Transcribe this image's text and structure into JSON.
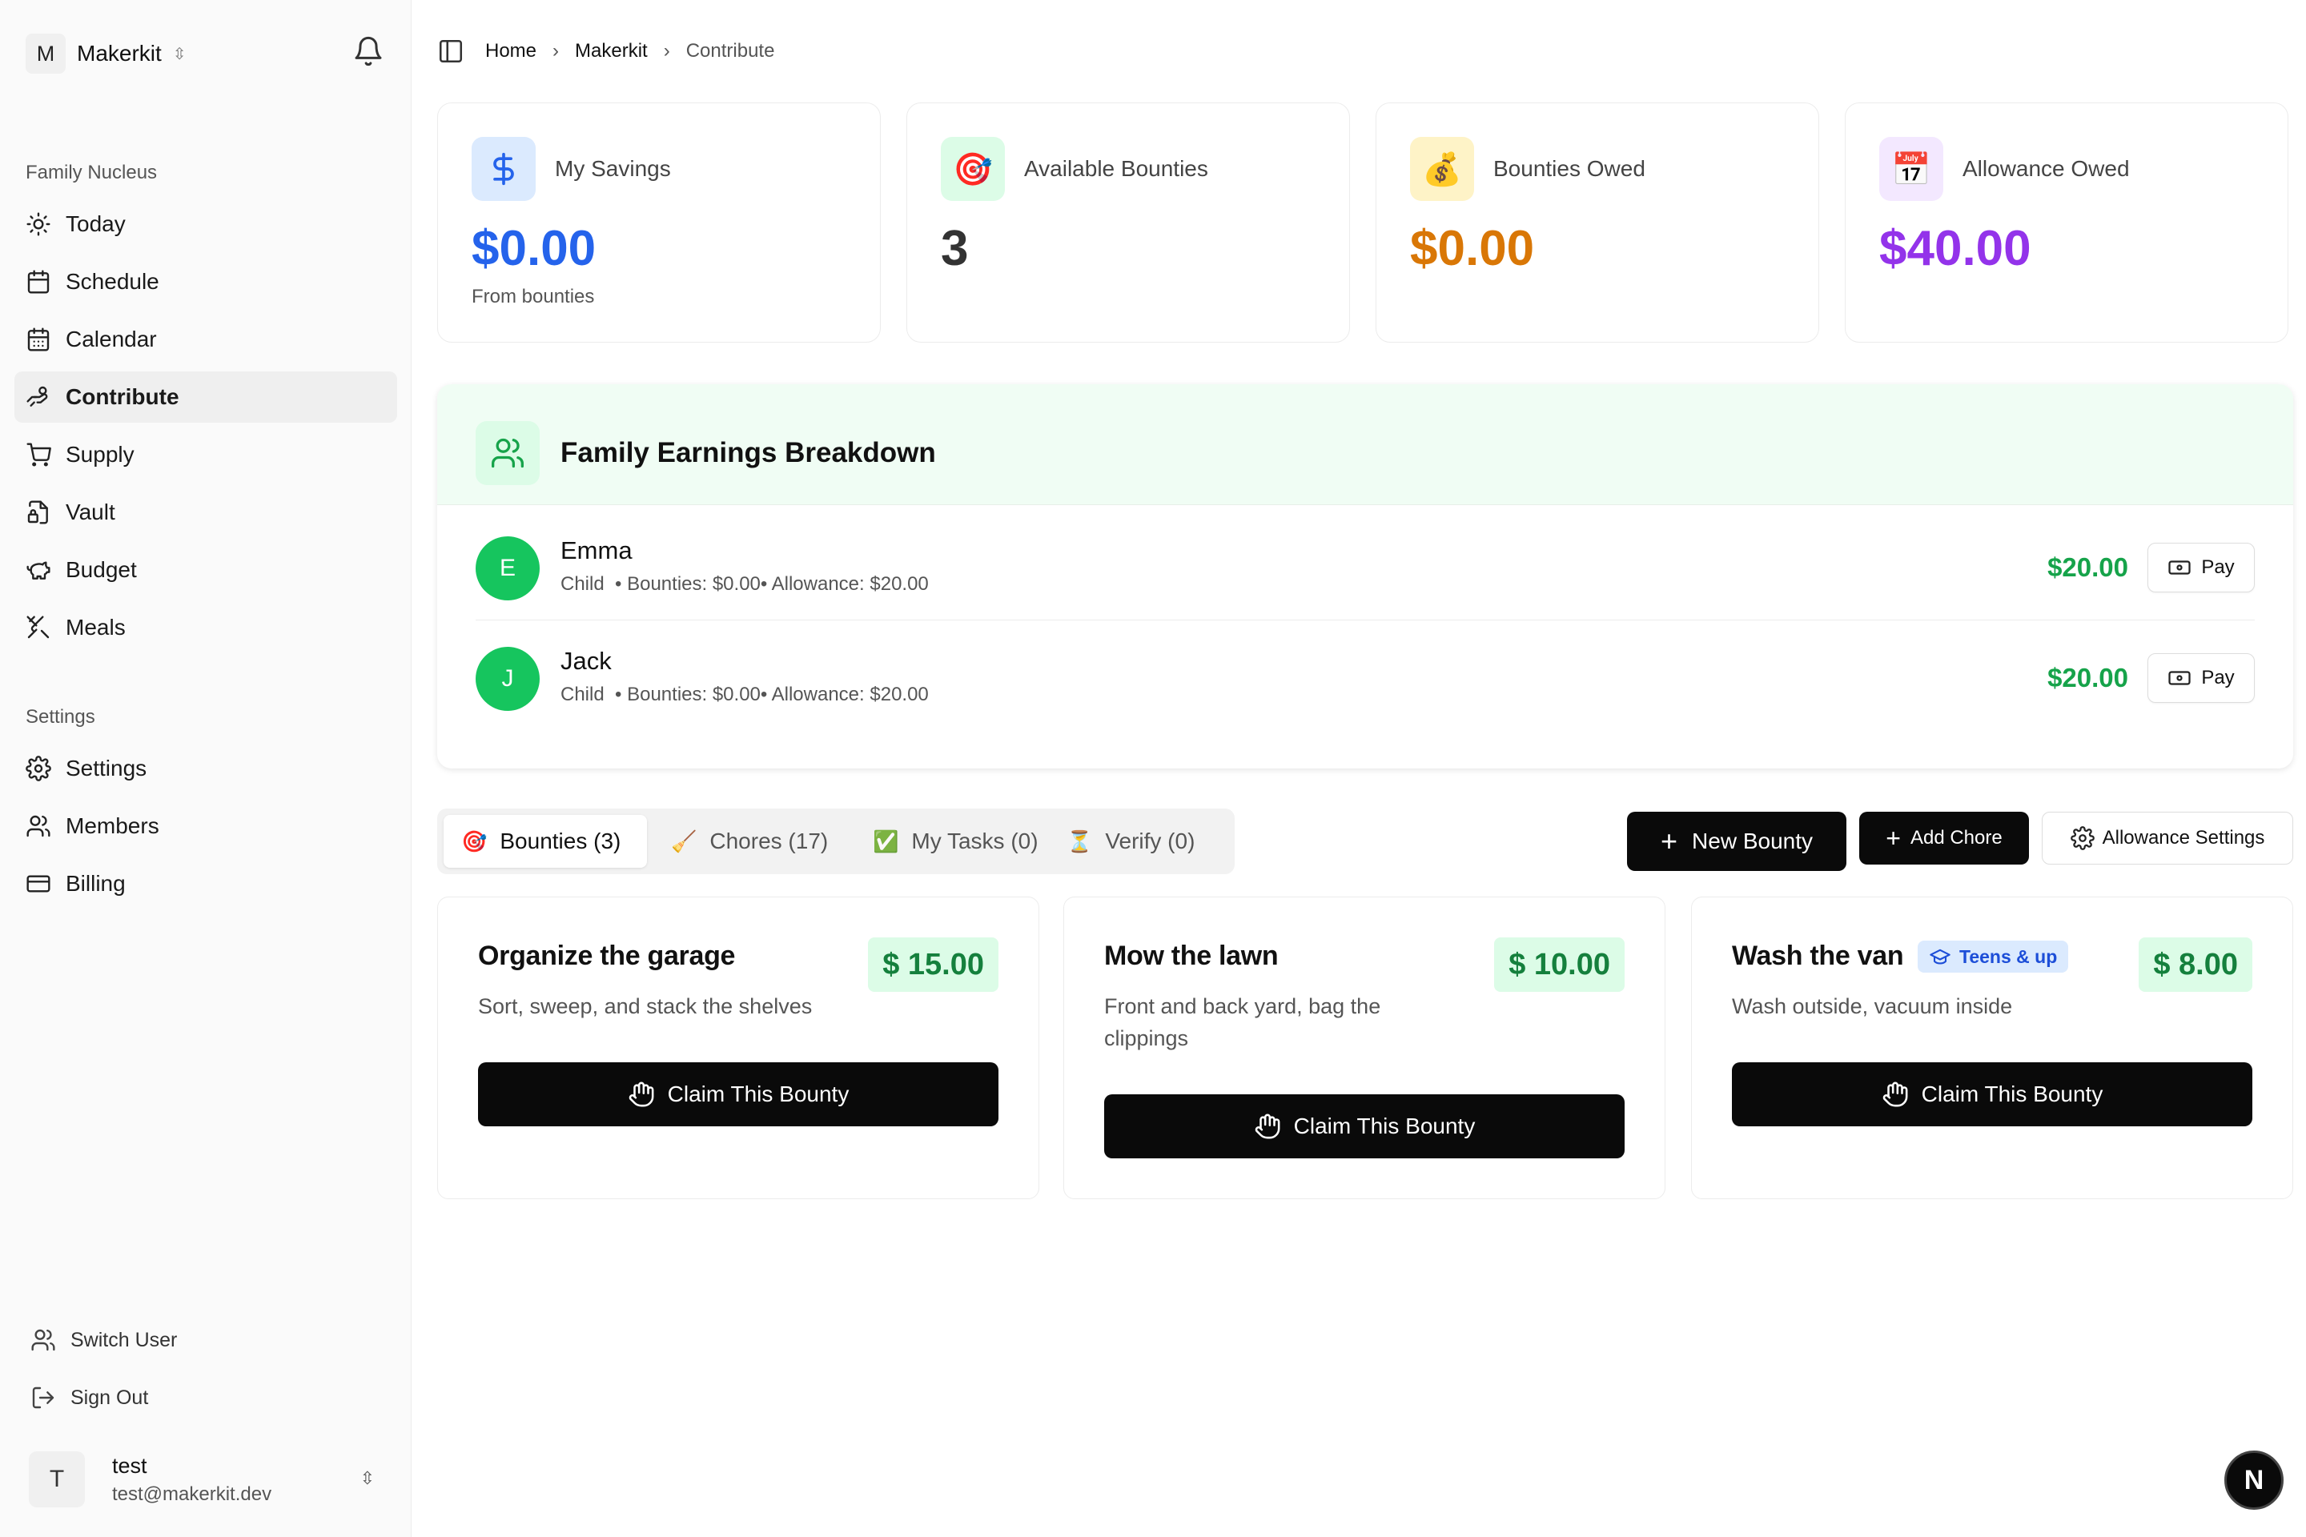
{
  "team": {
    "initial": "M",
    "name": "Makerkit"
  },
  "sidebar": {
    "group1": "Family Nucleus",
    "items": [
      {
        "label": "Today",
        "icon": "sun-icon"
      },
      {
        "label": "Schedule",
        "icon": "calendar-icon"
      },
      {
        "label": "Calendar",
        "icon": "calendar-grid-icon"
      },
      {
        "label": "Contribute",
        "icon": "hand-coins-icon"
      },
      {
        "label": "Supply",
        "icon": "cart-icon"
      },
      {
        "label": "Vault",
        "icon": "file-lock-icon"
      },
      {
        "label": "Budget",
        "icon": "piggy-bank-icon"
      },
      {
        "label": "Meals",
        "icon": "utensils-icon"
      }
    ],
    "group2": "Settings",
    "settings_items": [
      {
        "label": "Settings",
        "icon": "gear-icon"
      },
      {
        "label": "Members",
        "icon": "users-icon"
      },
      {
        "label": "Billing",
        "icon": "credit-card-icon"
      }
    ],
    "switch_user": "Switch User",
    "sign_out": "Sign Out",
    "user": {
      "initial": "T",
      "name": "test",
      "email": "test@makerkit.dev"
    }
  },
  "breadcrumb": {
    "home": "Home",
    "team": "Makerkit",
    "current": "Contribute"
  },
  "stats": [
    {
      "label": "My Savings",
      "value": "$0.00",
      "sub": "From bounties",
      "icon": "dollar-icon",
      "color": "#2563eb",
      "bg": "#dbeafe"
    },
    {
      "label": "Available Bounties",
      "value": "3",
      "sub": "",
      "icon": "🎯",
      "color": "#333333",
      "bg": "#dcfce7"
    },
    {
      "label": "Bounties Owed",
      "value": "$0.00",
      "sub": "",
      "icon": "💰",
      "color": "#d97706",
      "bg": "#fef3c7"
    },
    {
      "label": "Allowance Owed",
      "value": "$40.00",
      "sub": "",
      "icon": "📅",
      "color": "#9333ea",
      "bg": "#f3e8ff"
    }
  ],
  "earnings": {
    "title": "Family Earnings Breakdown",
    "members": [
      {
        "initial": "E",
        "name": "Emma",
        "meta": "Child  • Bounties: $0.00• Allowance: $20.00",
        "amount": "$20.00",
        "pay": "Pay"
      },
      {
        "initial": "J",
        "name": "Jack",
        "meta": "Child  • Bounties: $0.00• Allowance: $20.00",
        "amount": "$20.00",
        "pay": "Pay"
      }
    ]
  },
  "tabs": [
    {
      "emoji": "🎯",
      "label": "Bounties (3)",
      "active": true
    },
    {
      "emoji": "🧹",
      "label": "Chores (17)"
    },
    {
      "emoji": "✅",
      "label": "My Tasks (0)"
    },
    {
      "emoji": "⏳",
      "label": "Verify (0)"
    }
  ],
  "actions": {
    "new_bounty": "New Bounty",
    "add_chore": "Add Chore",
    "allowance_settings": "Allowance Settings"
  },
  "bounties": [
    {
      "title": "Organize the garage",
      "desc": "Sort, sweep, and stack the shelves",
      "amount": "$ 15.00",
      "claim": "Claim This Bounty"
    },
    {
      "title": "Mow the lawn",
      "desc": "Front and back yard, bag the clippings",
      "amount": "$ 10.00",
      "claim": "Claim This Bounty"
    },
    {
      "title": "Wash the van",
      "desc": "Wash outside, vacuum inside",
      "amount": "$ 8.00",
      "claim": "Claim This Bounty",
      "badge": "Teens & up"
    }
  ],
  "fab": "N"
}
